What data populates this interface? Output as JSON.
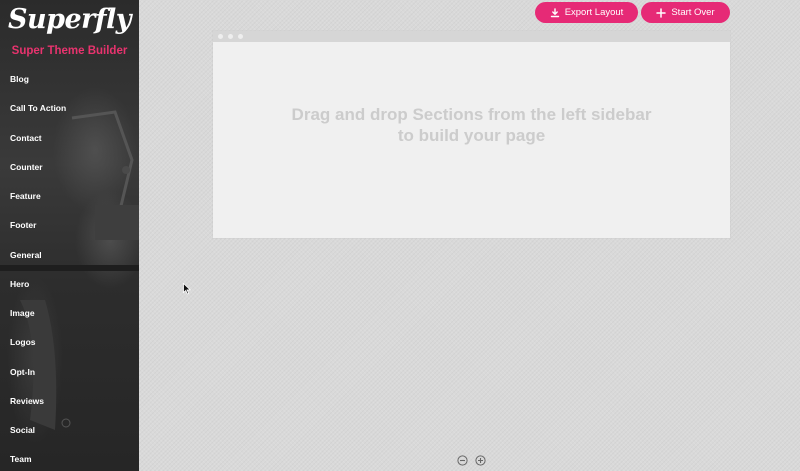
{
  "sidebar": {
    "logo": "Superfly",
    "subtitle": "Super Theme Builder",
    "items": [
      {
        "label": "Blog"
      },
      {
        "label": "Call To Action"
      },
      {
        "label": "Contact"
      },
      {
        "label": "Counter"
      },
      {
        "label": "Feature"
      },
      {
        "label": "Footer"
      },
      {
        "label": "General"
      },
      {
        "label": "Hero"
      },
      {
        "label": "Image"
      },
      {
        "label": "Logos"
      },
      {
        "label": "Opt-In"
      },
      {
        "label": "Reviews"
      },
      {
        "label": "Social"
      },
      {
        "label": "Team"
      }
    ]
  },
  "toolbar": {
    "export_label": "Export Layout",
    "export_icon": "download-icon",
    "start_over_label": "Start Over",
    "start_over_icon": "plus-icon"
  },
  "canvas": {
    "placeholder_line1": "Drag and drop Sections from the left sidebar",
    "placeholder_line2": "to build your page"
  },
  "zoom": {
    "out_icon": "zoom-out-icon",
    "in_icon": "zoom-in-icon"
  },
  "colors": {
    "accent": "#e62a76",
    "subtitle": "#e8336e",
    "background": "#d9d9d9",
    "canvas": "#f0f0f0",
    "sidebar": "#2b2b2b"
  }
}
